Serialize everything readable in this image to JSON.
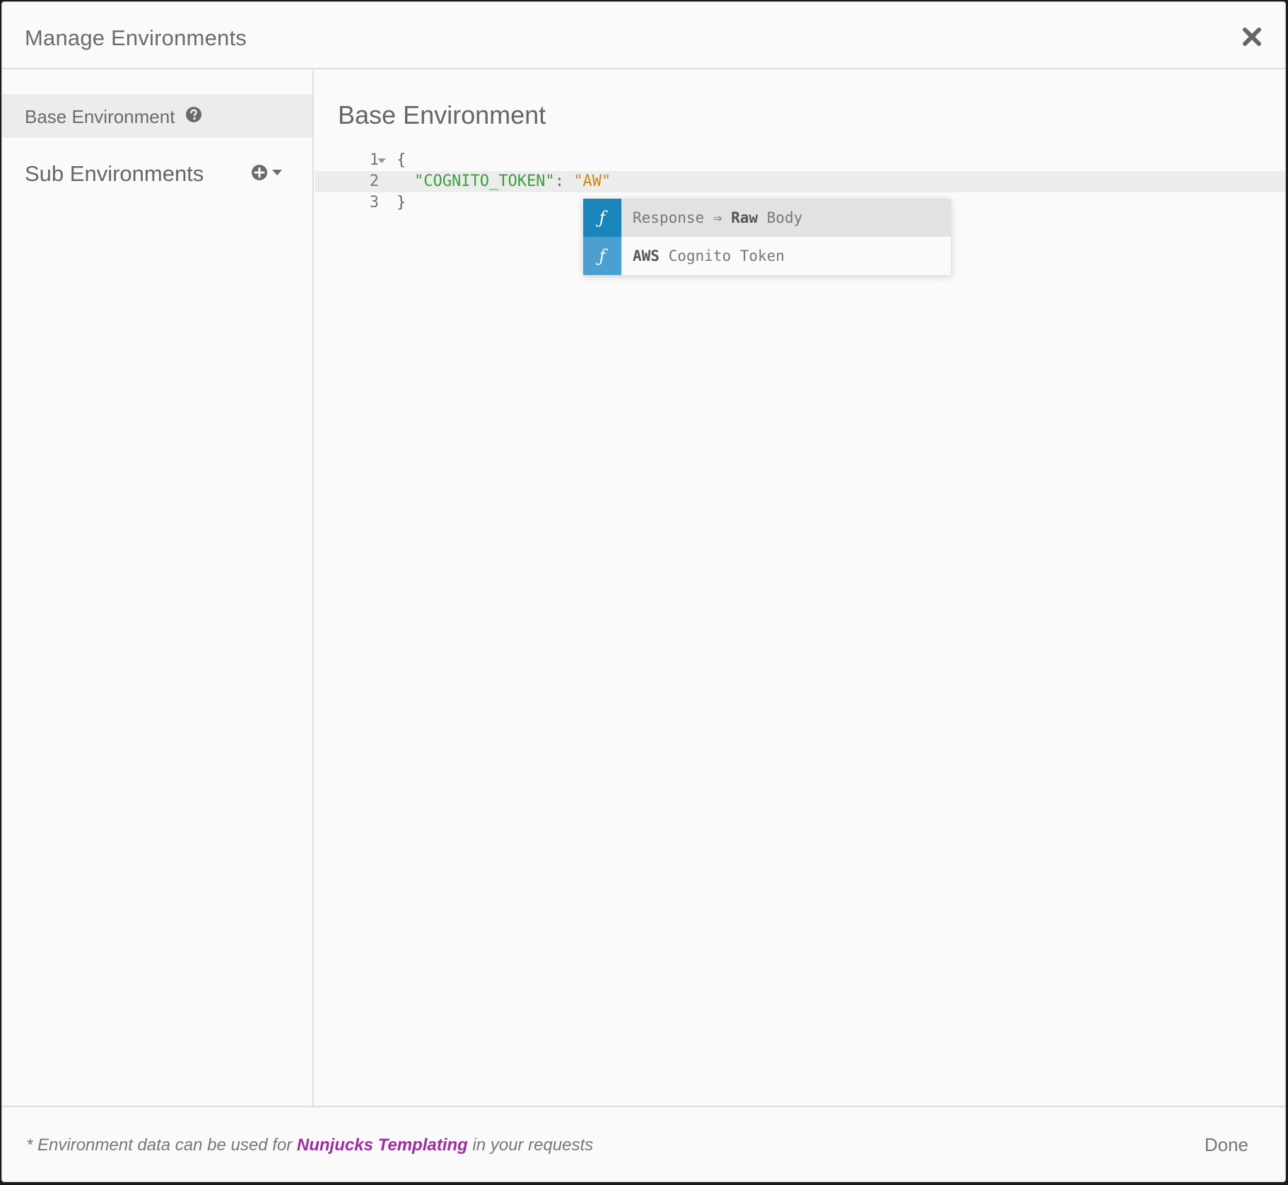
{
  "dialog": {
    "title": "Manage Environments",
    "close_icon": "close-icon"
  },
  "sidebar": {
    "base_environment_label": "Base Environment",
    "help_icon": "question-circle-icon",
    "sub_environments_label": "Sub Environments",
    "add_icon": "plus-circle-icon",
    "dropdown_icon": "caret-down-icon"
  },
  "main": {
    "heading": "Base Environment",
    "editor": {
      "lines": [
        {
          "number": "1",
          "open_brace": "{"
        },
        {
          "number": "2",
          "key": "\"COGNITO_TOKEN\"",
          "colon": ": ",
          "value": "\"AW\""
        },
        {
          "number": "3",
          "close_brace": "}"
        }
      ]
    },
    "autocomplete": {
      "badge": "ƒ",
      "items": [
        {
          "prefix": "Response ⇒ ",
          "bold": "Raw",
          "suffix": " Body",
          "badge_color": "#1a85b8",
          "selected": true
        },
        {
          "prefix": "",
          "bold": "AWS",
          "suffix": " Cognito Token",
          "badge_color": "#4aa0d0",
          "selected": false
        }
      ]
    }
  },
  "footer": {
    "note_prefix": "* Environment data can be used for ",
    "note_link": "Nunjucks Templating",
    "note_suffix": " in your requests",
    "done_label": "Done"
  },
  "colors": {
    "link": "#a02da0",
    "json_key": "#3d9c3d",
    "json_string": "#c78a1a"
  }
}
